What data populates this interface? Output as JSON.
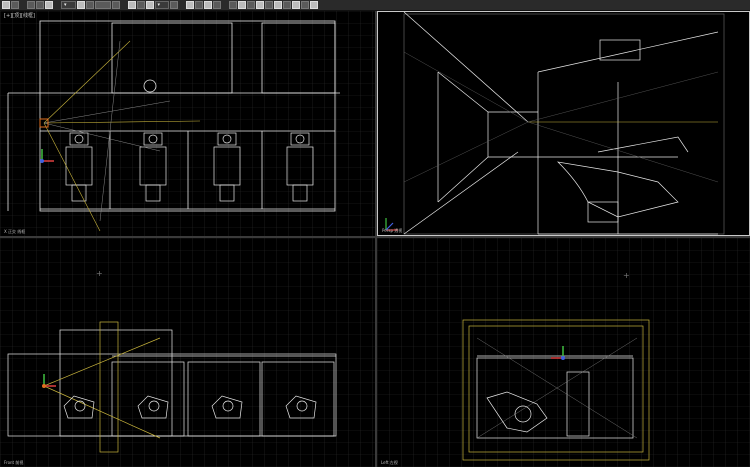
{
  "app": {
    "name": "3D modeling application",
    "colors": {
      "background": "#000000",
      "grid": "#2e2e2e",
      "grid_major": "#3c3c3c",
      "wire": "#e8e8e8",
      "yellow": "#c8b43c",
      "axis_x": "#e04040",
      "axis_y": "#40c040",
      "axis_z": "#4060e0",
      "orange": "#e07020"
    }
  },
  "toolbar": {
    "icons": [
      "undo-icon",
      "redo-icon",
      "link-icon",
      "unlink-icon",
      "bind-icon",
      "selection-filter-dropdown",
      "select-icon",
      "select-by-name-icon",
      "rectangular-selection-icon",
      "window-crossing-icon",
      "move-icon",
      "rotate-icon",
      "scale-icon",
      "reference-coordinate-dropdown",
      "pivot-icon",
      "snap-toggle-icon",
      "angle-snap-icon",
      "percent-snap-icon",
      "spinner-snap-icon",
      "named-selection-sets-icon",
      "mirror-icon",
      "align-icon",
      "layer-manager-icon",
      "curve-editor-icon",
      "schematic-view-icon",
      "material-editor-icon",
      "render-setup-icon",
      "rendered-frame-window-icon",
      "render-production-icon"
    ]
  },
  "viewports": {
    "top_left": {
      "label": "[+][顶][线框]",
      "axis_label": "X 正交 线框"
    },
    "top_right": {
      "label": "",
      "axis_label": "Persp 透视"
    },
    "bottom_left": {
      "label": "",
      "axis_label": "Front 前视"
    },
    "bottom_right": {
      "label": "",
      "axis_label": "Left 左视"
    }
  }
}
